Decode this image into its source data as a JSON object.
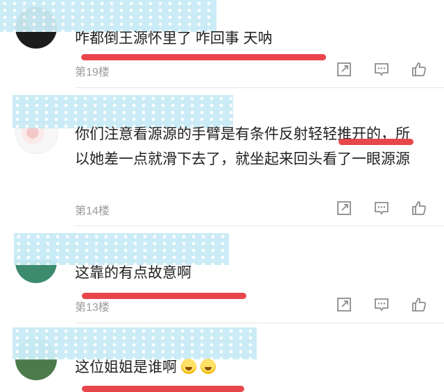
{
  "comments": [
    {
      "text": "咋都倒王源怀里了 咋回事 天呐",
      "floor": "第19楼"
    },
    {
      "text": "你们注意看源源的手臂是有条件反射轻轻推开的，所以她差一点就滑下去了，就坐起来回头看了一眼源源",
      "floor": "第14楼"
    },
    {
      "text": "这靠的有点故意啊",
      "floor": "第13楼"
    },
    {
      "text": "这位姐姐是谁啊",
      "floor": ""
    }
  ],
  "colors": {
    "highlight": "#e8464c",
    "mask": "#c9ecf6",
    "floor_text": "#9a9a9a",
    "icon": "#8c8c8c"
  },
  "icons": {
    "share": "share-icon",
    "reply": "comment-icon",
    "like": "thumbs-up-icon"
  }
}
